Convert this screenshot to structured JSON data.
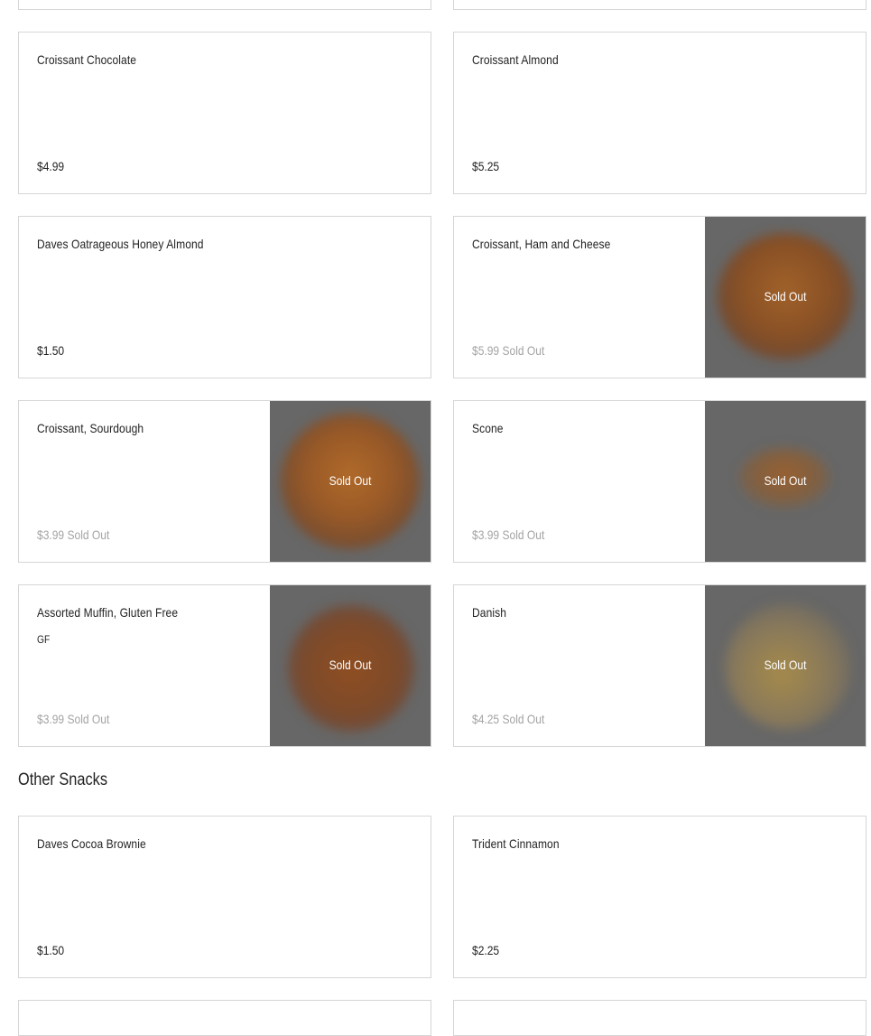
{
  "bakery_items": [
    {
      "name": "Croissant Chocolate",
      "price": "$4.99"
    },
    {
      "name": "Croissant Almond",
      "price": "$5.25"
    },
    {
      "name": "Daves Oatrageous Honey Almond",
      "price": "$1.50"
    },
    {
      "name": "Croissant, Ham and Cheese",
      "price": "$5.99 Sold Out",
      "image_label": "Sold Out"
    },
    {
      "name": "Croissant, Sourdough",
      "price": "$3.99 Sold Out",
      "image_label": "Sold Out"
    },
    {
      "name": "Scone",
      "price": "$3.99 Sold Out",
      "image_label": "Sold Out"
    },
    {
      "name": "Assorted Muffin, Gluten Free",
      "tag": "GF",
      "price": "$3.99 Sold Out",
      "image_label": "Sold Out"
    },
    {
      "name": "Danish",
      "price": "$4.25 Sold Out",
      "image_label": "Sold Out"
    }
  ],
  "other_snacks": {
    "title": "Other Snacks",
    "items": [
      {
        "name": "Daves Cocoa Brownie",
        "price": "$1.50"
      },
      {
        "name": "Trident Cinnamon",
        "price": "$2.25"
      }
    ]
  }
}
